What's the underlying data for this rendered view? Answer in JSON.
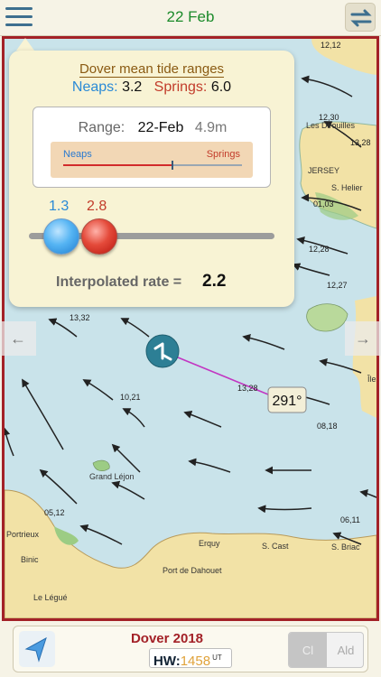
{
  "header": {
    "date": "22 Feb",
    "menu_icon": "hamburger-menu-icon",
    "swap_icon": "swap-arrows-icon"
  },
  "popup": {
    "title": "Dover mean tide ranges",
    "neaps_label": "Neaps:",
    "neaps_value": "3.2",
    "springs_label": "Springs:",
    "springs_value": "6.0",
    "range_label": "Range:",
    "range_date": "22-Feb",
    "range_value": "4.9m",
    "bar_neaps_label": "Neaps",
    "bar_springs_label": "Springs",
    "range_fraction": 0.61,
    "slider_left_value": "1.3",
    "slider_right_value": "2.8",
    "interpolated_label": "Interpolated rate =",
    "interpolated_value": "2.2"
  },
  "map": {
    "bearing_label": "291°",
    "place_labels": [
      "Les Dirouilles",
      "JERSEY",
      "S. Helier",
      "Grand Léjon",
      "Erquy",
      "S. Cast",
      "S. Briac",
      "Port de Dahouet",
      "Binic",
      "Portrieux",
      "Le Légué",
      "Île"
    ],
    "flow_labels": [
      "12,12",
      "12,30",
      "13,28",
      "01,03",
      "12,28",
      "12,27",
      "13,32",
      "10,21",
      "13,28",
      "08,18",
      "06,11",
      "05,12"
    ],
    "colors": {
      "sea": "#c9e3ea",
      "land": "#f2e2a6",
      "border": "#a32127",
      "track": "#c236c2"
    }
  },
  "nav": {
    "left_arrow": "←",
    "right_arrow": "→"
  },
  "footer": {
    "port": "Dover 2018",
    "hw_label": "HW:",
    "hw_value": "1458",
    "hw_unit": "UT",
    "seg_cl": "Cl",
    "seg_ald": "Ald",
    "location_icon": "location-arrow-icon"
  }
}
